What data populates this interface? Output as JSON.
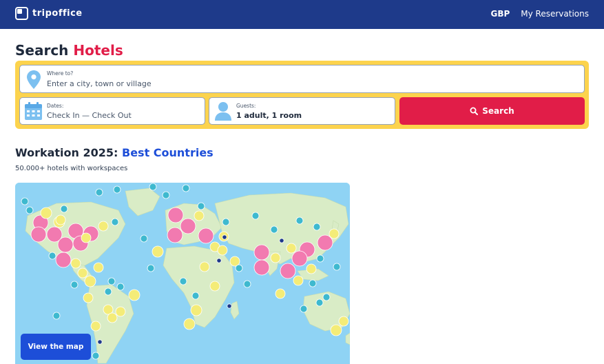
{
  "header": {
    "logo_text": "tripoffice",
    "currency": "GBP",
    "reservations": "My Reservations"
  },
  "page_title": {
    "prefix": "Search",
    "accent": "Hotels"
  },
  "search": {
    "where_label": "Where to?",
    "where_placeholder": "Enter a city, town or village",
    "dates_label": "Dates:",
    "dates_value": "Check In — Check Out",
    "guests_label": "Guests:",
    "guests_value": "1 adult, 1 room",
    "button_label": "Search"
  },
  "section": {
    "title_prefix": "Workation 2025:",
    "title_accent": "Best Countries",
    "subtitle": "50.000+ hotels with workspaces"
  },
  "map": {
    "button_label": "View the map"
  },
  "colors": {
    "header_bg": "#1e3a8a",
    "search_bg": "#fcd34d",
    "search_button": "#e11d48",
    "accent_blue": "#1d4ed8"
  }
}
